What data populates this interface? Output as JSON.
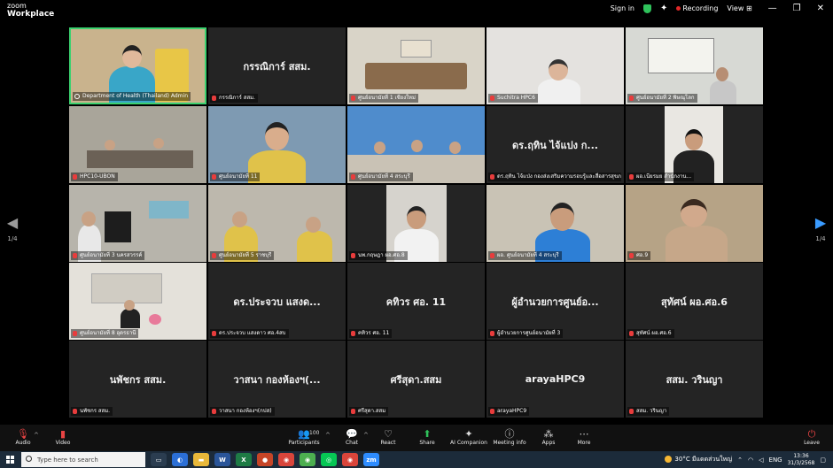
{
  "app": {
    "logo_line1": "zoom",
    "logo_line2": "Workplace"
  },
  "topbar": {
    "signin": "Sign in",
    "recording": "Recording",
    "view": "View",
    "view_icon": "grid-icon"
  },
  "pager": {
    "left": "1/4",
    "right": "1/4"
  },
  "tiles": [
    {
      "label": "Department of Health (Thailand) Admin",
      "big": ""
    },
    {
      "label": "กรรณิการ์ สสม.",
      "big": "กรรณิการ์ สสม."
    },
    {
      "label": "ศูนย์อนามัยที่ 1 เชียงใหม่",
      "big": ""
    },
    {
      "label": "Suchitra HPC6",
      "big": ""
    },
    {
      "label": "ศูนย์อนามัยที่ 2 พิษณุโลก",
      "big": ""
    },
    {
      "label": "HPC10-UBON",
      "big": ""
    },
    {
      "label": "ศูนย์อนามัยที่ 11",
      "big": ""
    },
    {
      "label": "ศูนย์อนามัยที่ 4 สระบุรี",
      "big": ""
    },
    {
      "label": "ดร.ฤทิน ไจ้แป่ง กองส่งเสริมความรอบรู้และสื่อสารสุขภาพ",
      "big": "ดร.ฤทิน ไจ้แปง ก..."
    },
    {
      "label": "ผอ.เนียรมย สำนักงาน...",
      "big": ""
    },
    {
      "label": "ศูนย์อนามัยที่ 3 นครสวรรค์",
      "big": ""
    },
    {
      "label": "ศูนย์อนามัยที่ 5 ราชบุรี",
      "big": ""
    },
    {
      "label": "นพ.กฤษฎา ผอ.ศอ.8",
      "big": ""
    },
    {
      "label": "ผอ. ศูนย์อนามัยที่ 4 สระบุรี",
      "big": ""
    },
    {
      "label": "ศอ.9",
      "big": ""
    },
    {
      "label": "ศูนย์อนามัยที่ 8 อุดรธานี",
      "big": ""
    },
    {
      "label": "ดร.ประจวบ แสงดาว ศอ.4สบ",
      "big": "ดร.ประจวบ แสงด..."
    },
    {
      "label": "คทิวร ศอ. 11",
      "big": "คทิวร ศอ. 11"
    },
    {
      "label": "ผู้อำนวยการศูนย์อนามัยที่ 3",
      "big": "ผู้อำนวยการศูนย์อ..."
    },
    {
      "label": "สุทัศน์ ผอ.ศอ.6",
      "big": "สุทัศน์ ผอ.ศอ.6"
    },
    {
      "label": "นพัชกร สสม.",
      "big": "นพัชกร สสม."
    },
    {
      "label": "วาสนา กองห้องฯ(กปส)",
      "big": "วาสนา กองห้องฯ(..."
    },
    {
      "label": "ศรีสุดา.สสม",
      "big": "ศรีสุดา.สสม"
    },
    {
      "label": "arayaHPC9",
      "big": "arayaHPC9"
    },
    {
      "label": "สสม. วรินญา",
      "big": "สสม. วรินญา"
    }
  ],
  "toolbar": {
    "audio": "Audio",
    "video": "Video",
    "participants": "Participants",
    "participants_count": "100",
    "chat": "Chat",
    "react": "React",
    "share": "Share",
    "ai": "AI Companion",
    "meeting_info": "Meeting info",
    "apps": "Apps",
    "more": "More",
    "leave": "Leave"
  },
  "taskbar": {
    "search_placeholder": "Type here to search",
    "weather": "30°C มีแดดส่วนใหญ่",
    "lang": "ENG",
    "time": "13:36",
    "date": "31/3/2568",
    "app_labels": {
      "excel": "X",
      "zoom": "zm"
    }
  },
  "colors": {
    "accent_active": "#3bd16f",
    "tile_bg": "#242424",
    "nav_blue": "#3a9bff",
    "recording_red": "#e02828"
  }
}
